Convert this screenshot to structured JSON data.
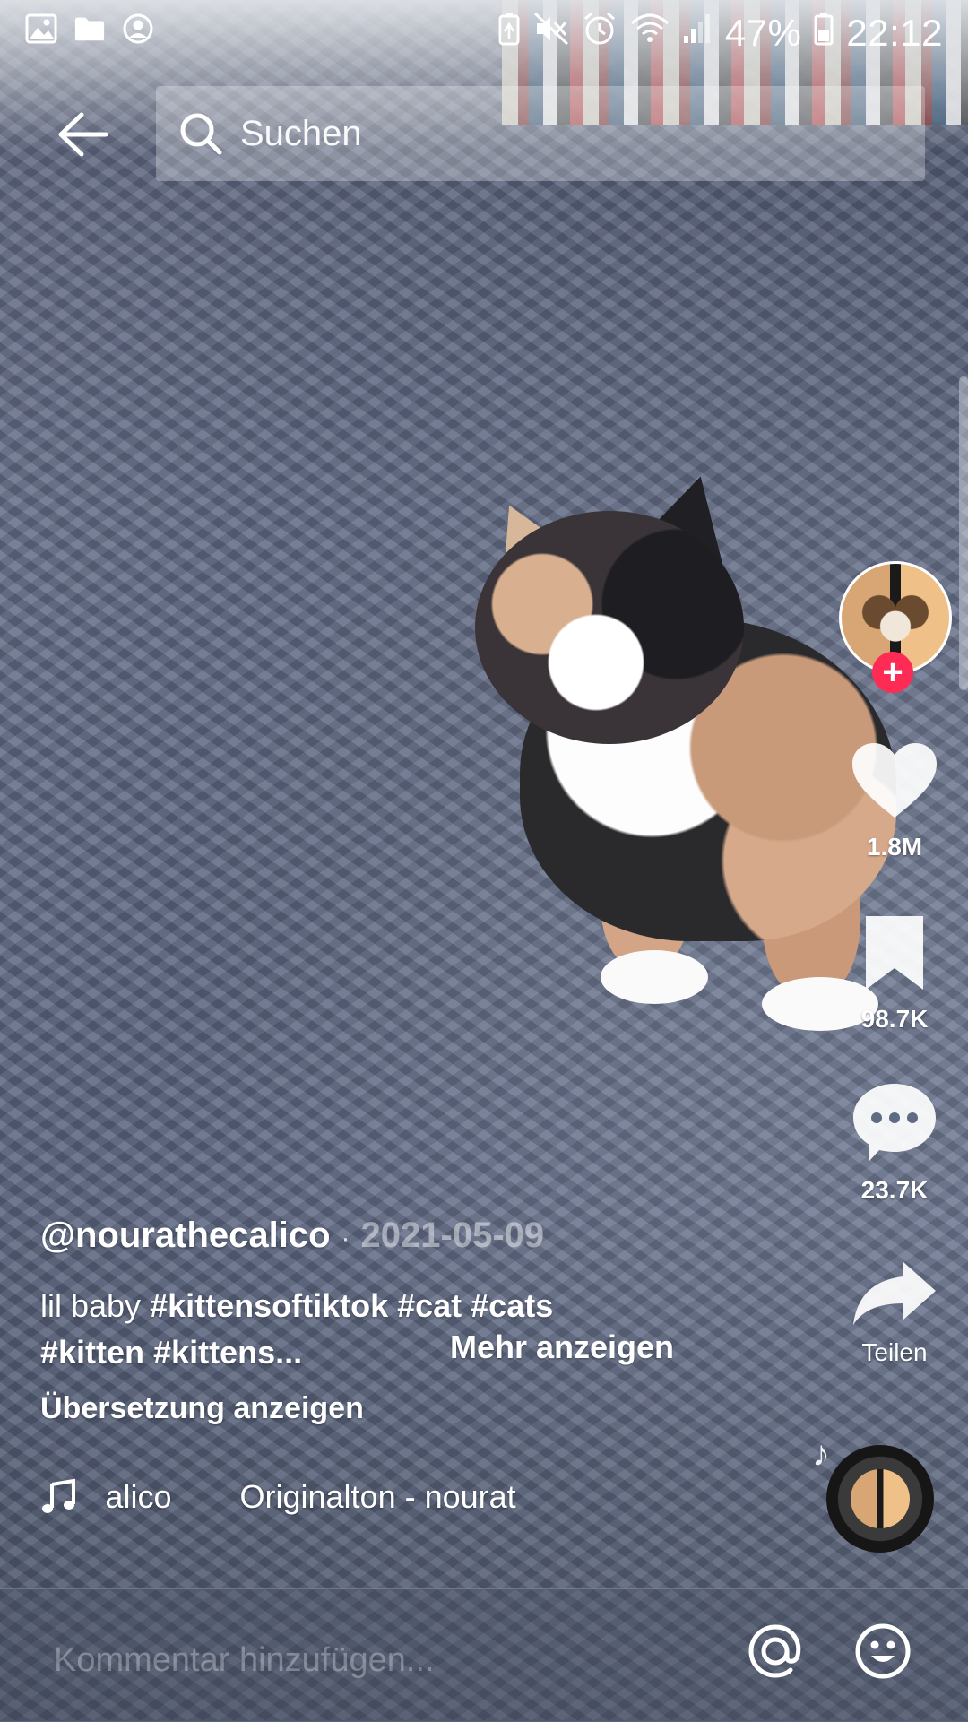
{
  "status_bar": {
    "battery_percent": "47%",
    "time": "22:12",
    "left_icons": [
      "gallery-icon",
      "folder-icon",
      "account-icon"
    ],
    "right_icons": [
      "battery-saver-icon",
      "mute-icon",
      "alarm-icon",
      "wifi-icon",
      "signal-icon",
      "battery-icon"
    ]
  },
  "top_bar": {
    "back_icon": "back-arrow-icon",
    "search_placeholder": "Suchen"
  },
  "actions": {
    "likes": "1.8M",
    "saves": "98.7K",
    "comments": "23.7K",
    "share_label": "Teilen"
  },
  "caption": {
    "author": "@nourathecalico",
    "separator": "·",
    "date": "2021-05-09",
    "line1_plain": "lil baby ",
    "line1_tags": "#kittensoftiktok #cat #cats",
    "line2_tags": "#kitten #kittens...",
    "more": "Mehr anzeigen",
    "translate": "Übersetzung anzeigen"
  },
  "music": {
    "part1": "alico",
    "part2": "Originalton - nourat"
  },
  "comment_bar": {
    "placeholder": "Kommentar hinzufügen..."
  },
  "colors": {
    "accent": "#fe2c55",
    "text": "#ffffff"
  }
}
